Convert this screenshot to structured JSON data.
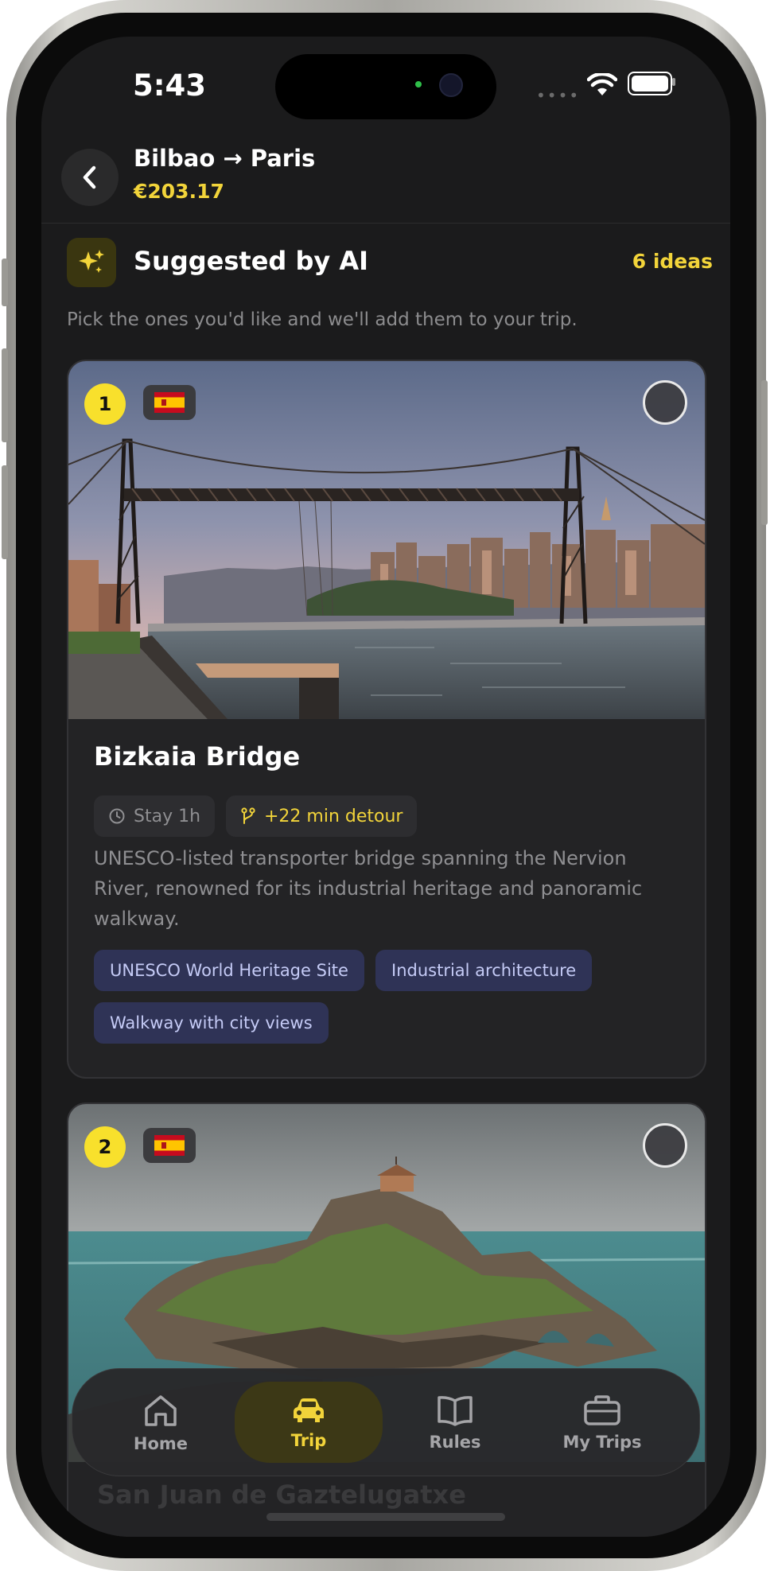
{
  "status_bar": {
    "time": "5:43",
    "signal_dots": "••••"
  },
  "header": {
    "title": "Bilbao → Paris",
    "price": "€203.17"
  },
  "section": {
    "title": "Suggested by AI",
    "count": "6 ideas",
    "subtitle": "Pick the ones you'd like and we'll add them to your trip."
  },
  "cards": [
    {
      "number": "1",
      "country_flag": "spain-flag-icon",
      "title": "Bizkaia Bridge",
      "stay": "Stay 1h",
      "detour": "+22 min detour",
      "description": "UNESCO-listed transporter bridge spanning the Nervion River, renowned for its industrial heritage and panoramic walkway.",
      "tags": [
        "UNESCO World Heritage Site",
        "Industrial architecture",
        "Walkway with city views"
      ],
      "selected": false
    },
    {
      "number": "2",
      "country_flag": "spain-flag-icon",
      "title": "San Juan de Gaztelugatxe",
      "selected": false
    }
  ],
  "tabbar": {
    "tabs": [
      {
        "label": "Home",
        "icon": "home-icon"
      },
      {
        "label": "Trip",
        "icon": "car-icon"
      },
      {
        "label": "Rules",
        "icon": "book-icon"
      },
      {
        "label": "My Trips",
        "icon": "briefcase-icon"
      }
    ],
    "active": "Trip"
  },
  "colors": {
    "accent": "#f2d43a",
    "background": "#1b1b1c",
    "card": "#232325",
    "tag_bg": "#2f3356",
    "tag_text": "#c5cbf6"
  }
}
